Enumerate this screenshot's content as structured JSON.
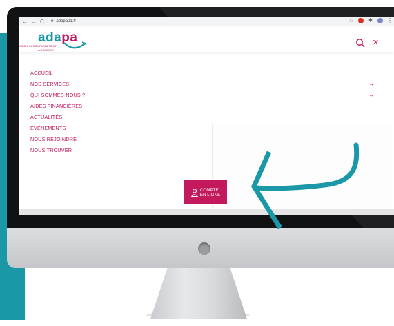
{
  "browser": {
    "back": "←",
    "forward": "→",
    "reload": "C",
    "url": "adapa01.fr"
  },
  "header": {
    "logo_part1": "ada",
    "logo_part2": "pa",
    "logo_tagline_1": "AIDE & ACCOMPAGNEMENT",
    "logo_tagline_2": "A DOMICILE",
    "close_symbol": "×"
  },
  "menu": {
    "items": [
      {
        "label": "ACCUEIL",
        "arrow": ""
      },
      {
        "label": "NOS SERVICES",
        "arrow": "→"
      },
      {
        "label": "QUI SOMMES-NOUS ?",
        "arrow": "→"
      },
      {
        "label": "AIDES FINANCIÈRES",
        "arrow": ""
      },
      {
        "label": "ACTUALITÉS",
        "arrow": ""
      },
      {
        "label": "ÉVÉNEMENTS",
        "arrow": ""
      },
      {
        "label": "NOUS REJOINDRE",
        "arrow": "→"
      },
      {
        "label": "NOUS TROUVER",
        "arrow": ""
      }
    ]
  },
  "cta": {
    "line1": "COMPTE",
    "line2": "EN LIGNE"
  },
  "colors": {
    "brand_pink": "#c3195d",
    "brand_teal": "#1b98a7",
    "bezel": "#111214"
  }
}
